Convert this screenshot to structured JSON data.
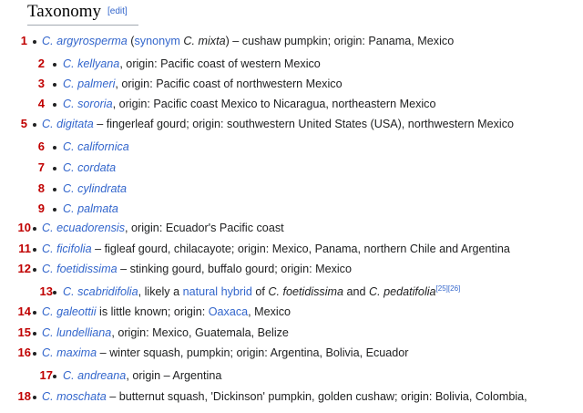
{
  "section": {
    "title": "Taxonomy",
    "edit_label": "[edit]"
  },
  "items": [
    {
      "number": "1",
      "level": 1,
      "name": "C. argyrosperma",
      "paren_open": " (",
      "syn_link": "synonym",
      "syn_name": " C. mixta",
      "paren_close": ")",
      "desc": " – cushaw pumpkin; origin: Panama, Mexico"
    },
    {
      "number": "2",
      "level": 2,
      "name": "C. kellyana",
      "desc": ", origin: Pacific coast of western Mexico"
    },
    {
      "number": "3",
      "level": 2,
      "name": "C. palmeri",
      "desc": ", origin: Pacific coast of northwestern Mexico"
    },
    {
      "number": "4",
      "level": 2,
      "name": "C. sororia",
      "desc": ", origin: Pacific coast Mexico to Nicaragua, northeastern Mexico"
    },
    {
      "number": "5",
      "level": 1,
      "name": "C. digitata",
      "desc": " – fingerleaf gourd; origin: southwestern United States (USA), northwestern Mexico"
    },
    {
      "number": "6",
      "level": 2,
      "name": "C. californica",
      "desc": ""
    },
    {
      "number": "7",
      "level": 2,
      "name": "C. cordata",
      "desc": ""
    },
    {
      "number": "8",
      "level": 2,
      "name": "C. cylindrata",
      "desc": ""
    },
    {
      "number": "9",
      "level": 2,
      "name": "C. palmata",
      "desc": ""
    },
    {
      "number": "10",
      "level": 1,
      "name": "C. ecuadorensis",
      "desc": ", origin: Ecuador's Pacific coast"
    },
    {
      "number": "11",
      "level": 1,
      "name": "C. ficifolia",
      "desc": " – figleaf gourd, chilacayote; origin: Mexico, Panama, northern Chile and Argentina"
    },
    {
      "number": "12",
      "level": 1,
      "name": "C. foetidissima",
      "desc": " – stinking gourd, buffalo gourd; origin: Mexico"
    },
    {
      "number": "13",
      "level": 2,
      "name": "C. scabridifolia",
      "t1": ", likely a ",
      "hybrid_link": "natural hybrid",
      "t2": " of ",
      "sp1": "C. foetidissima",
      "t3": " and ",
      "sp2": "C. pedatifolia",
      "refs": "[25][26]"
    },
    {
      "number": "14",
      "level": 1,
      "name": "C. galeottii",
      "desc": " is little known; origin: ",
      "place_link": "Oaxaca",
      "desc2": ", Mexico"
    },
    {
      "number": "15",
      "level": 1,
      "name": "C. lundelliana",
      "desc": ", origin: Mexico, Guatemala, Belize"
    },
    {
      "number": "16",
      "level": 1,
      "name": "C. maxima",
      "desc": " – winter squash, pumpkin; origin: Argentina, Bolivia, Ecuador"
    },
    {
      "number": "17",
      "level": 2,
      "name": "C. andreana",
      "desc": ", origin – Argentina"
    },
    {
      "number": "18",
      "level": 1,
      "name": "C. moschata",
      "desc": " – butternut squash, 'Dickinson' pumpkin, golden cushaw; origin: Bolivia, Colombia,"
    }
  ]
}
